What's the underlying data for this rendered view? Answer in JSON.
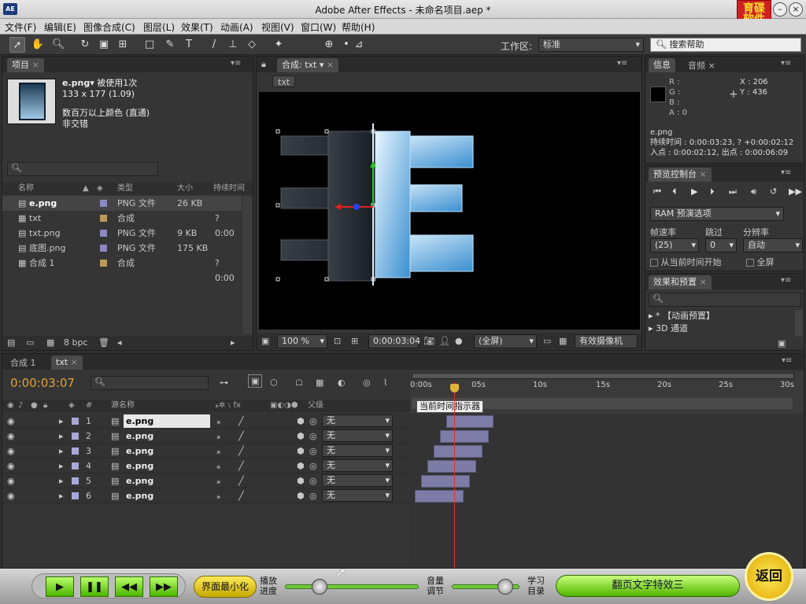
{
  "window": {
    "title": "Adobe After Effects - 未命名项目.aep *",
    "logo": "AE",
    "brand": "育碟\n软件"
  },
  "menus": [
    "文件(F)",
    "编辑(E)",
    "图像合成(C)",
    "图层(L)",
    "效果(T)",
    "动画(A)",
    "视图(V)",
    "窗口(W)",
    "帮助(H)"
  ],
  "toolbar": {
    "workspace_label": "工作区:",
    "workspace_value": "标准",
    "search_placeholder": "搜索帮助"
  },
  "project": {
    "tab": "项目",
    "file_name": "e.png▾",
    "usage": "被使用1次",
    "dims": "133 x 177 (1.09)",
    "color": "数百万以上颜色 (直通)",
    "interlace": "非交错",
    "columns": {
      "name": "名称",
      "type": "类型",
      "size": "大小",
      "duration": "持续时间"
    },
    "items": [
      {
        "name": "e.png",
        "type": "PNG 文件",
        "size": "26 KB",
        "duration": "",
        "color": "#8a8ac0"
      },
      {
        "name": "txt",
        "type": "合成",
        "size": "",
        "duration": "? 0:00",
        "color": "#b89a5a"
      },
      {
        "name": "txt.png",
        "type": "PNG 文件",
        "size": "9 KB",
        "duration": "",
        "color": "#8a8ac0"
      },
      {
        "name": "底图.png",
        "type": "PNG 文件",
        "size": "175 KB",
        "duration": "",
        "color": "#8a8ac0"
      },
      {
        "name": "合成 1",
        "type": "合成",
        "size": "",
        "duration": "? 0:00",
        "color": "#b89a5a"
      }
    ],
    "bpc": "8 bpc"
  },
  "comp": {
    "tab": "合成: txt",
    "breadcrumb": "txt",
    "zoom": "100 %",
    "timecode": "0:00:03:04",
    "resolution": "(全屏)",
    "camera": "有效摄像机"
  },
  "info": {
    "tab_info": "信息",
    "tab_audio": "音频",
    "r": "R :",
    "g": "G :",
    "b": "B :",
    "a": "A : 0",
    "x": "X : 206",
    "y": "Y : 436",
    "name": "e.png",
    "duration": "持续时间 : 0:00:03:23, ? +0:00:02:12",
    "inout": "入点 : 0:00:02:12, 出点 : 0:00:06:09"
  },
  "preview": {
    "tab": "预览控制台",
    "ram": "RAM 预演选项",
    "frame_rate_label": "帧速率",
    "skip_label": "跳过",
    "res_label": "分辨率",
    "frame_rate": "(25)",
    "skip": "0",
    "res": "自动",
    "from_current": "从当前时间开始",
    "fullscreen": "全屏"
  },
  "effects": {
    "tab": "效果和预置",
    "items": [
      "* 【动画预置】",
      "3D 通道"
    ]
  },
  "timeline": {
    "tab_comp1": "合成 1",
    "tab_txt": "txt",
    "time": "0:00:03:07",
    "tooltip": "当前时间指示器",
    "col_num": "#",
    "col_source": "源名称",
    "col_parent": "父级",
    "ruler": [
      "0:00s",
      "05s",
      "10s",
      "15s",
      "20s",
      "25s",
      "30s"
    ],
    "layers": [
      {
        "num": "1",
        "name": "e.png",
        "parent": "无"
      },
      {
        "num": "2",
        "name": "e.png",
        "parent": "无"
      },
      {
        "num": "3",
        "name": "e.png",
        "parent": "无"
      },
      {
        "num": "4",
        "name": "e.png",
        "parent": "无"
      },
      {
        "num": "5",
        "name": "e.png",
        "parent": "无"
      },
      {
        "num": "6",
        "name": "e.png",
        "parent": "无"
      }
    ]
  },
  "player": {
    "minimize": "界面最小化",
    "progress_label": "播放\n进度",
    "volume_label": "音量\n调节",
    "study_label": "学习\n目录",
    "lesson": "翻页文字特效三",
    "back": "返回"
  }
}
